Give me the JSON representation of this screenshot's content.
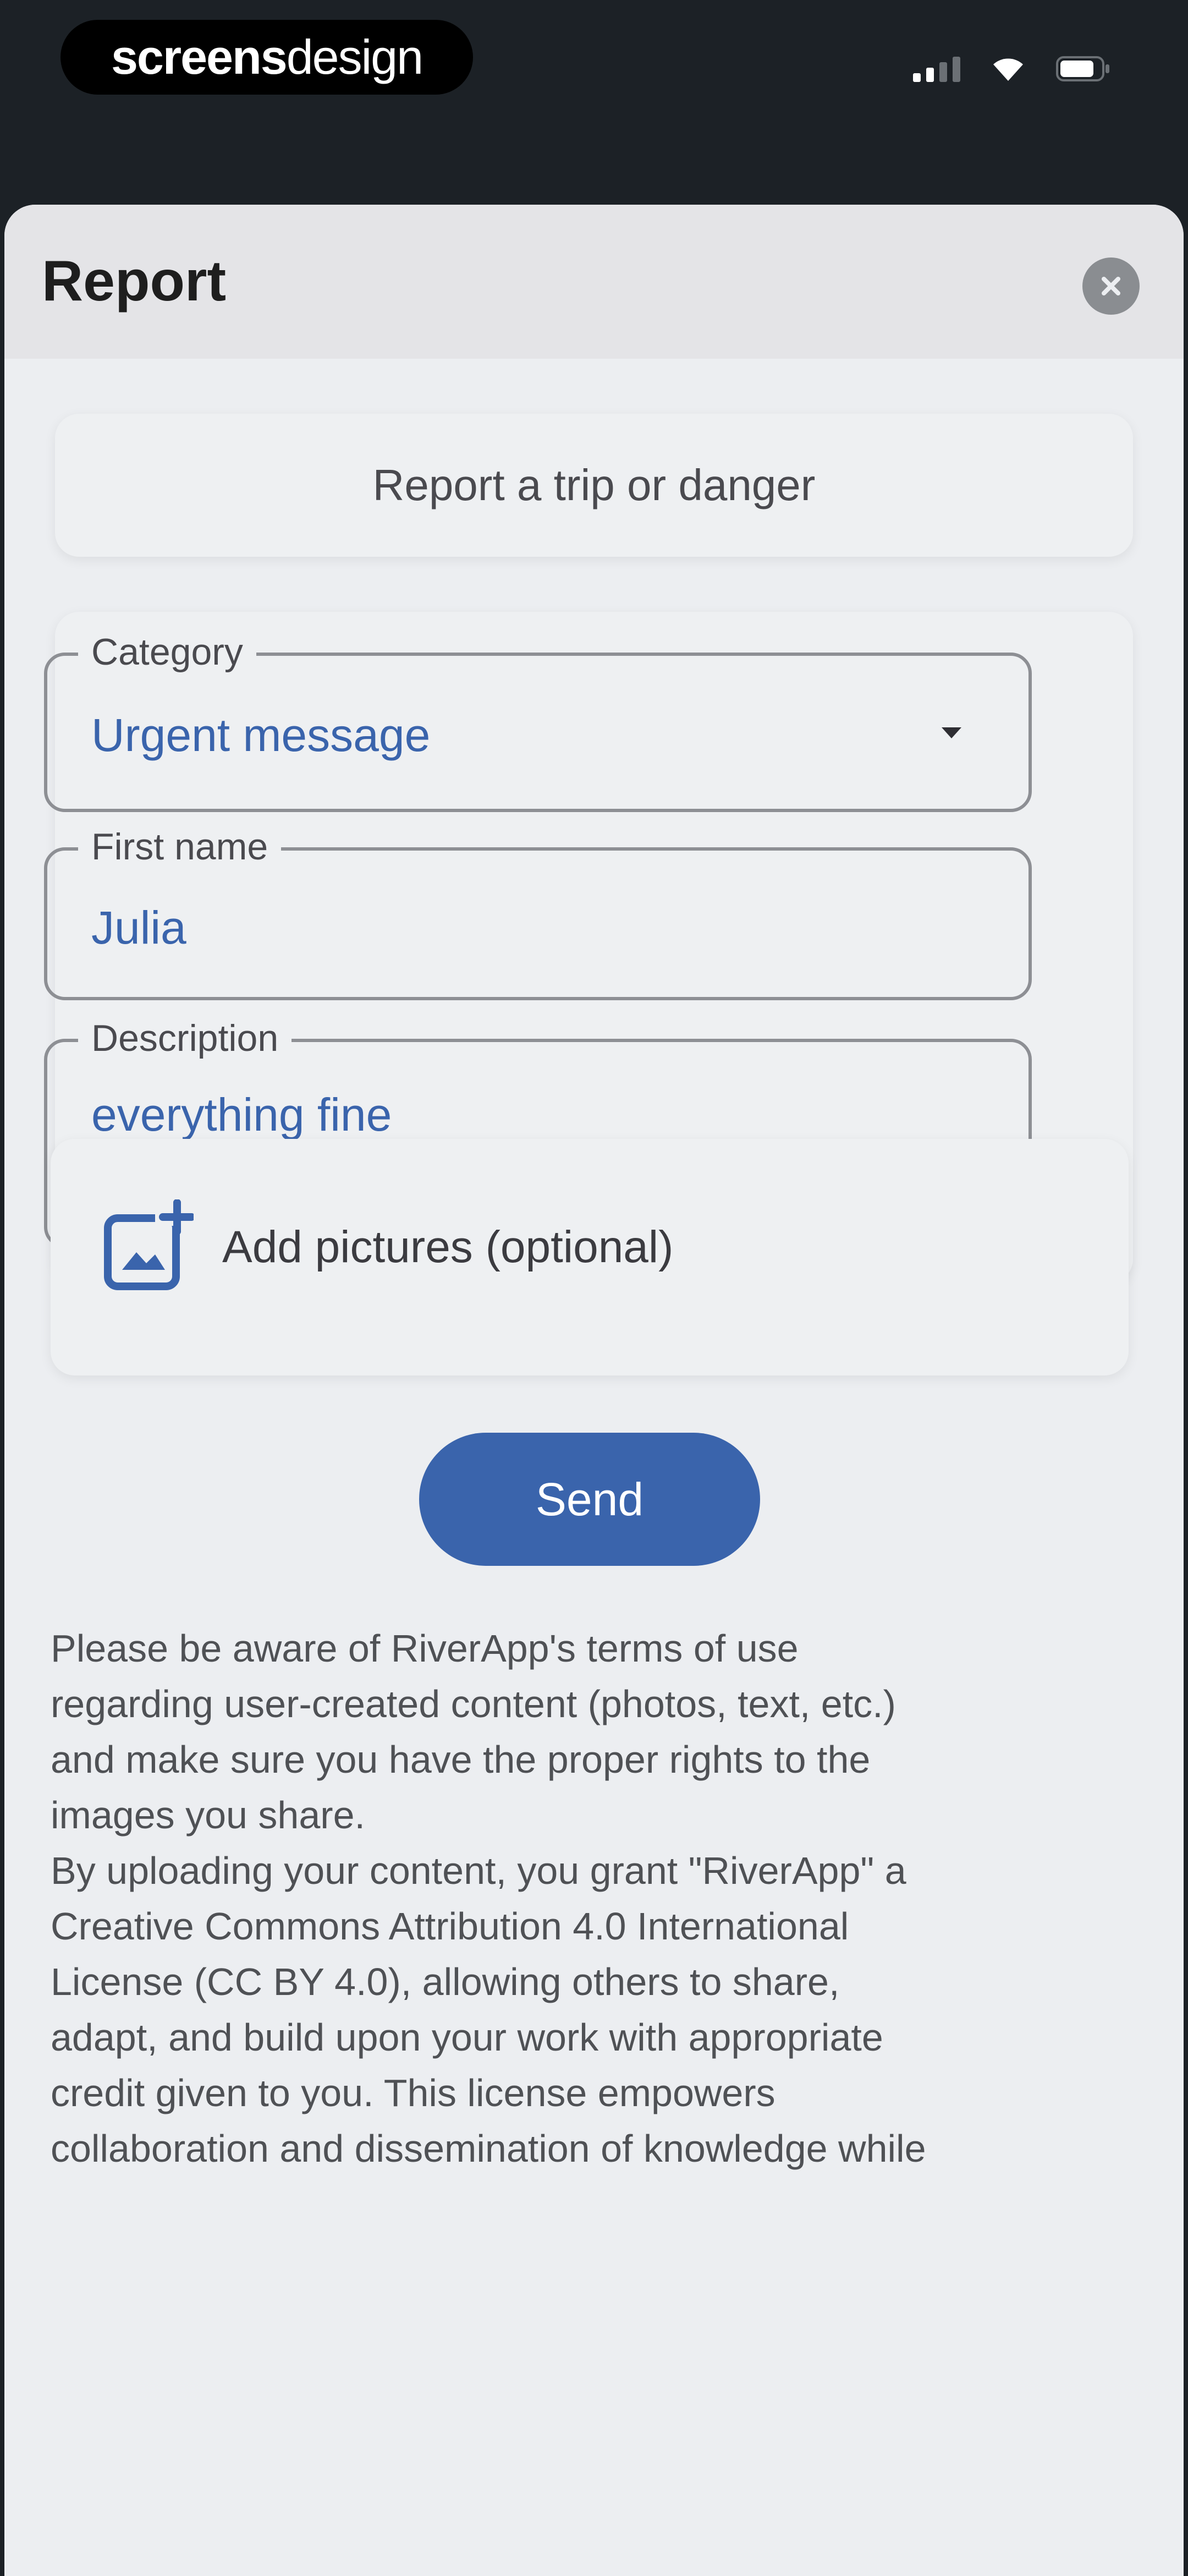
{
  "status_bar": {
    "brand_bold": "screens",
    "brand_light": "design",
    "icons": [
      "signal-icon",
      "wifi-icon",
      "battery-icon"
    ]
  },
  "sheet": {
    "title": "Report",
    "close_icon": "close-icon"
  },
  "report_card": {
    "label": "Report a trip or danger"
  },
  "form": {
    "category": {
      "label": "Category",
      "value": "Urgent message",
      "icon": "dropdown-arrow-icon"
    },
    "first_name": {
      "label": "First name",
      "value": "Julia"
    },
    "description": {
      "label": "Description",
      "value": "everything fine"
    }
  },
  "pictures": {
    "label": "Add pictures (optional)",
    "icon": "add-photo-icon"
  },
  "send_button": {
    "label": "Send"
  },
  "terms": {
    "lines": [
      "Please be aware of RiverApp's terms of use",
      "regarding user-created content (photos, text, etc.)",
      "and make sure you have the proper rights to the",
      "images you share.",
      "By uploading your content, you grant \"RiverApp\" a",
      "Creative Commons Attribution 4.0 International",
      "License (CC BY 4.0), allowing others to share,",
      "adapt, and build upon your work with appropriate",
      "credit given to you. This license empowers",
      "collaboration and dissemination of knowledge while"
    ]
  },
  "colors": {
    "accent": "#3a64ac",
    "status_bar_bg": "#1c2126",
    "sheet_bg": "#eceef1",
    "header_bg": "#e4e4e7"
  }
}
